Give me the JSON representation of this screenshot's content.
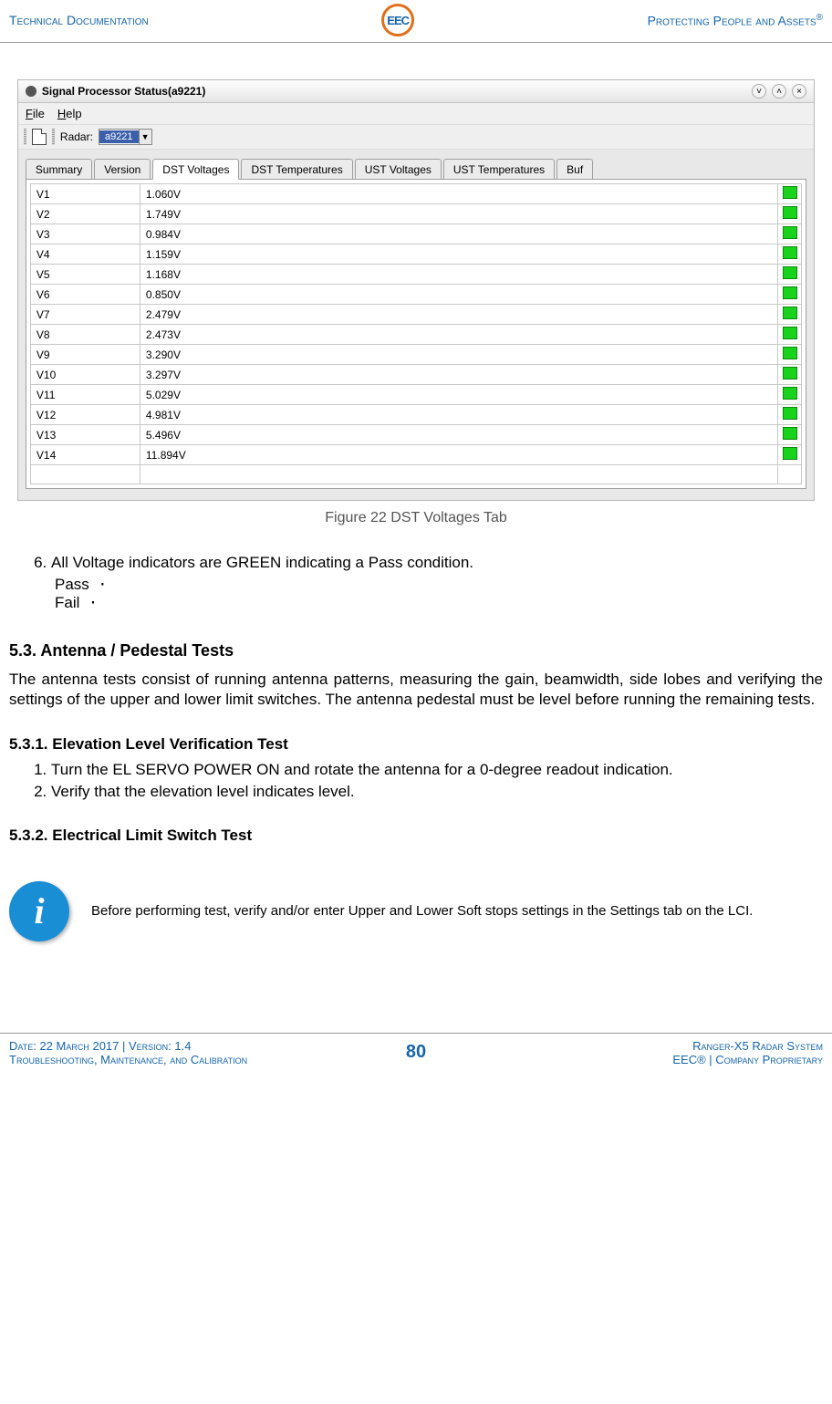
{
  "header": {
    "left": "Technical Documentation",
    "logo_text": "EEC",
    "right": "Protecting People and Assets",
    "reg": "®"
  },
  "window": {
    "title": "Signal Processor Status(a9221)",
    "menu": {
      "file": "File",
      "help": "Help"
    },
    "toolbar": {
      "radar_label": "Radar:",
      "radar_value": "a9221"
    },
    "tabs": [
      "Summary",
      "Version",
      "DST Voltages",
      "DST Temperatures",
      "UST Voltages",
      "UST Temperatures",
      "Buf"
    ],
    "active_tab": 2,
    "rows": [
      {
        "name": "V1",
        "value": "1.060V"
      },
      {
        "name": "V2",
        "value": "1.749V"
      },
      {
        "name": "V3",
        "value": "0.984V"
      },
      {
        "name": "V4",
        "value": "1.159V"
      },
      {
        "name": "V5",
        "value": "1.168V"
      },
      {
        "name": "V6",
        "value": "0.850V"
      },
      {
        "name": "V7",
        "value": "2.479V"
      },
      {
        "name": "V8",
        "value": "2.473V"
      },
      {
        "name": "V9",
        "value": "3.290V"
      },
      {
        "name": "V10",
        "value": "3.297V"
      },
      {
        "name": "V11",
        "value": "5.029V"
      },
      {
        "name": "V12",
        "value": "4.981V"
      },
      {
        "name": "V13",
        "value": "5.496V"
      },
      {
        "name": "V14",
        "value": "11.894V"
      }
    ]
  },
  "figure_caption": "Figure 22 DST Voltages Tab",
  "step6": {
    "num": "6.",
    "text": "All Voltage indicators are GREEN indicating a Pass condition.",
    "pass": "Pass",
    "fail": "Fail",
    "dot": "·"
  },
  "sec53": {
    "heading": "5.3.    Antenna / Pedestal Tests",
    "para": "The antenna tests consist of running antenna patterns, measuring the gain, beamwidth, side lobes and verifying the settings of the upper and lower limit switches.  The antenna pedestal must be level before running the remaining tests."
  },
  "sec531": {
    "heading": "5.3.1.   Elevation Level Verification Test",
    "items": [
      "Turn the EL SERVO POWER ON and rotate the antenna for a 0-degree readout indication.",
      "Verify that the elevation level indicates level."
    ]
  },
  "sec532": {
    "heading": "5.3.2.   Electrical Limit Switch Test"
  },
  "info_note": "Before performing test, verify and/or enter Upper and Lower Soft stops settings in the Settings tab on the LCI.",
  "footer": {
    "left1": "Date: 22 March 2017 | Version: 1.4",
    "left2": "Troubleshooting, Maintenance, and Calibration",
    "page": "80",
    "right1": "Ranger-X5 Radar System",
    "right2": "EEC® | Company Proprietary"
  }
}
